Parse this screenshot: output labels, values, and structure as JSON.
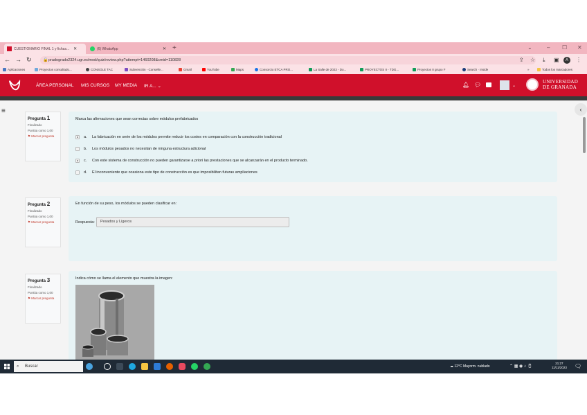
{
  "browser": {
    "tabs": [
      {
        "title": "CUESTIONARIO FINAL 1 y fichas...",
        "active": true
      },
      {
        "title": "(6) WhatsApp",
        "active": false
      }
    ],
    "window_controls": [
      "⌄",
      "–",
      "☐",
      "✕"
    ],
    "url": "pradogrado2324.ugr.es/mod/quiz/review.php?attempt=1460208&cmid=110828",
    "bookmarks": [
      "Aplicaciones",
      "Proyectos consultado...",
      "CONSOLE TAC",
      "Subvención - Conselle...",
      "Gmail",
      "YouTube",
      "Maps",
      "Consorcio ETCA PRO...",
      "La Salle de 2023 - Do...",
      "PROYECTOS II - TDG...",
      "Proyectos II grupo F",
      "Search · Inside",
      "Todos los marcadores"
    ]
  },
  "moodle": {
    "nav": [
      "ÁREA PERSONAL",
      "MIS CURSOS",
      "MY MEDIA",
      "IR A... ⌄"
    ],
    "university_name": [
      "UNIVERSIDAD",
      "DE GRANADA"
    ]
  },
  "questions": [
    {
      "label": "Pregunta",
      "number": "1",
      "status": "Finalizado",
      "score": "Puntúa como 1,00",
      "flag_label": "Marcar pregunta",
      "text": "Marca las afirmaciones que sean correctas sobre módulos prefabricados",
      "options": [
        {
          "letter": "a.",
          "text": "La fabricación en serie de los módulos permite reducir los costes en comparación con la construcción tradicional",
          "checked": true
        },
        {
          "letter": "b.",
          "text": "Los módulos pesados no necesitan de ninguna estructura adicional",
          "checked": false
        },
        {
          "letter": "c.",
          "text": "Con este sistema de construcción no pueden garantizarse a priori las prestaciones que se alcanzarán en el producto terminado.",
          "checked": true
        },
        {
          "letter": "d.",
          "text": "El inconveniente que ocasiona este tipo de construcción es que imposibilitan futuras ampliaciones",
          "checked": false
        }
      ]
    },
    {
      "label": "Pregunta",
      "number": "2",
      "status": "Finalizado",
      "score": "Puntúa como 1,00",
      "flag_label": "Marcar pregunta",
      "text": "En función de su peso, los módulos se pueden clasificar en:",
      "answer_label": "Respuesta:",
      "answer_value": "Pesados y Ligeros"
    },
    {
      "label": "Pregunta",
      "number": "3",
      "status": "Finalizado",
      "score": "Puntúa como 1,00",
      "flag_label": "Marcar pregunta",
      "text": "Indica cómo se llama el elemento que muestra la imagen:"
    }
  ],
  "ui": {
    "help": "?",
    "drawer": "≡",
    "collapse": "‹"
  },
  "taskbar": {
    "search_placeholder": "Buscar",
    "weather": "12°C Mayorm. nublado",
    "time": "21:27",
    "date": "11/11/2023"
  },
  "colors": {
    "moodle_red": "#d0102b",
    "tab_pink": "#f2b6c0",
    "question_bg": "#e7f3f5",
    "taskbar": "#1f2a36"
  }
}
